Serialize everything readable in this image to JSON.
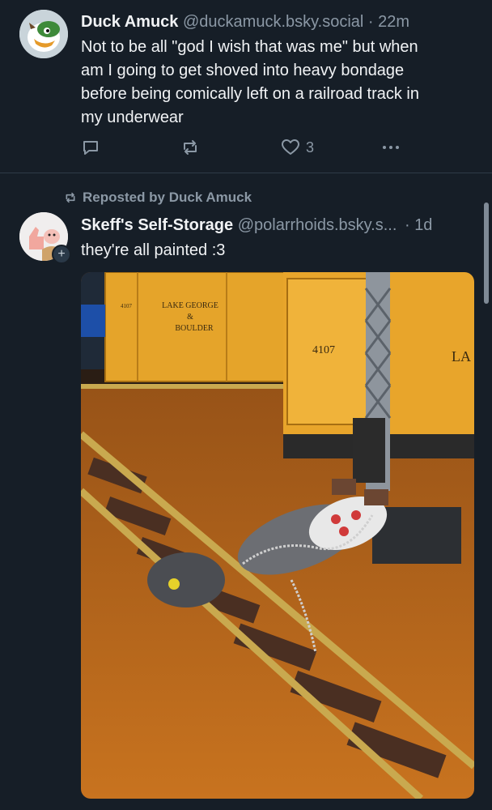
{
  "post1": {
    "display_name": "Duck Amuck",
    "handle": "@duckamuck.bsky.social",
    "separator": "·",
    "time": "22m",
    "text_lines": [
      "Not to be all \"god I wish that was me\" but when",
      "am I going to get shoved into heavy bondage",
      "before being comically left on a railroad track in",
      "my underwear"
    ],
    "like_count": "3",
    "icons": {
      "reply": "reply-icon",
      "repost": "repost-icon",
      "like": "heart-icon",
      "more": "more-icon"
    }
  },
  "repost": {
    "label": "Reposted by Duck Amuck"
  },
  "post2": {
    "display_name": "Skeff's Self-Storage",
    "handle": "@polarrhoids.bsky.s...",
    "separator": "·",
    "time": "1d",
    "text": "they're all painted :3",
    "follow_badge": "+",
    "photo": {
      "car_label_1": "LAKE GEORGE",
      "car_label_2": "&",
      "car_label_3": "BOULDER",
      "car_number": "4107",
      "car_partial": "LA",
      "small_number": "4107"
    }
  },
  "colors": {
    "background": "#161e27",
    "muted": "#8b98a5",
    "text": "#f1f3f5",
    "accent": "#208bfe"
  }
}
